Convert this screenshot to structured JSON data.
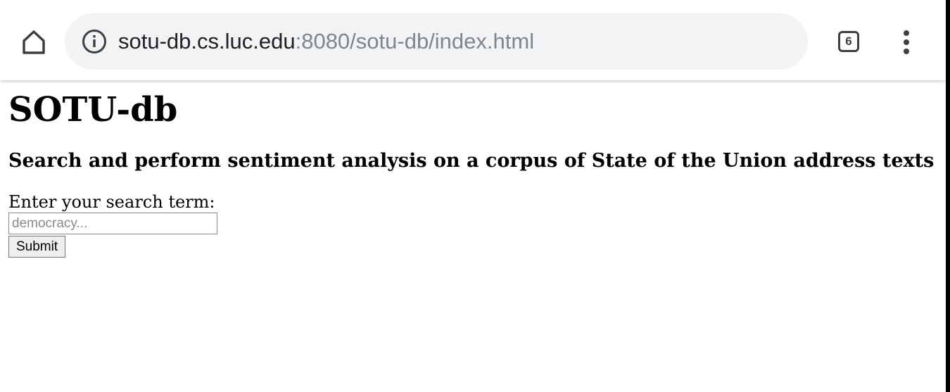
{
  "browser": {
    "url_host": "sotu-db.cs.luc.edu",
    "url_path": ":8080/sotu-db/index.html",
    "tab_count": "6",
    "icons": [
      "home-icon",
      "info-icon",
      "tab-switcher-icon",
      "more-vert-icon"
    ]
  },
  "page": {
    "title": "SOTU-db",
    "subtitle": "Search and perform sentiment analysis on a corpus of State of the Union address texts",
    "search_label": "Enter your search term:",
    "search_placeholder": "democracy...",
    "search_value": "",
    "submit_label": "Submit"
  },
  "colors": {
    "omnibox_bg": "#f1f3f4",
    "url_host": "#202124",
    "url_path": "#80868b",
    "icon": "#3c4043"
  }
}
